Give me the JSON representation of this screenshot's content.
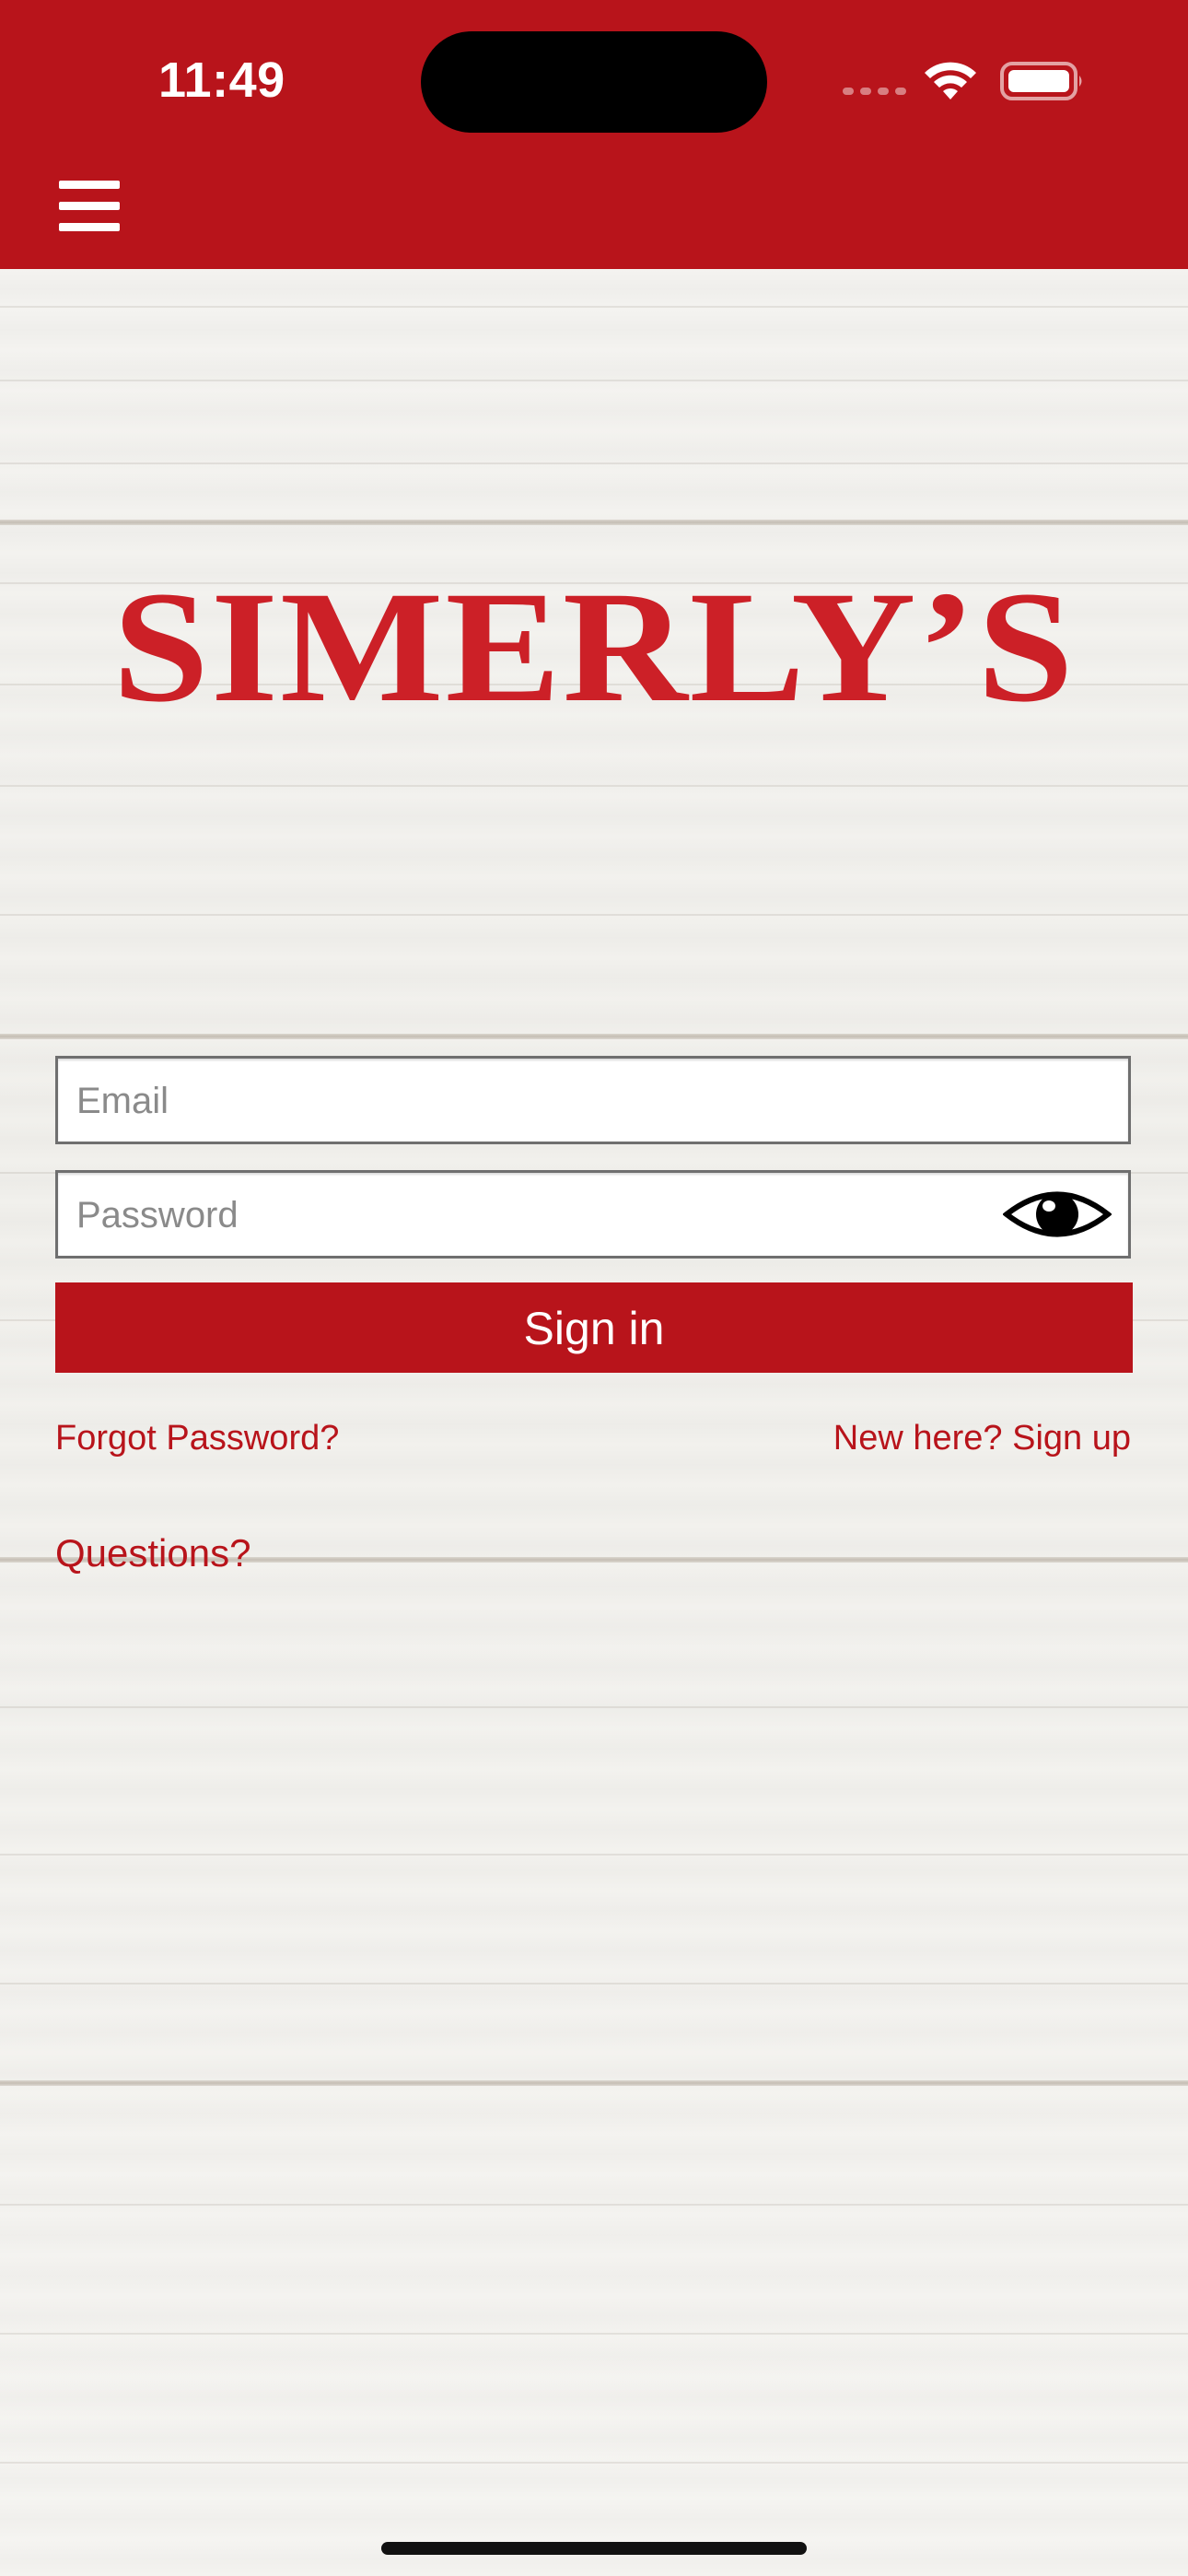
{
  "status_bar": {
    "time": "11:49"
  },
  "header": {
    "menu_icon": "hamburger-menu-icon",
    "bar_color": "#b8141b"
  },
  "logo": {
    "text": "SIMERLY’S",
    "color": "#cc2027"
  },
  "form": {
    "email_placeholder": "Email",
    "email_value": "",
    "password_placeholder": "Password",
    "password_value": "",
    "show_password_icon": "eye-icon",
    "signin_label": "Sign in"
  },
  "links": {
    "forgot_password": "Forgot Password?",
    "sign_up": "New here? Sign up",
    "questions": "Questions?"
  },
  "accent_color": "#b8141b"
}
